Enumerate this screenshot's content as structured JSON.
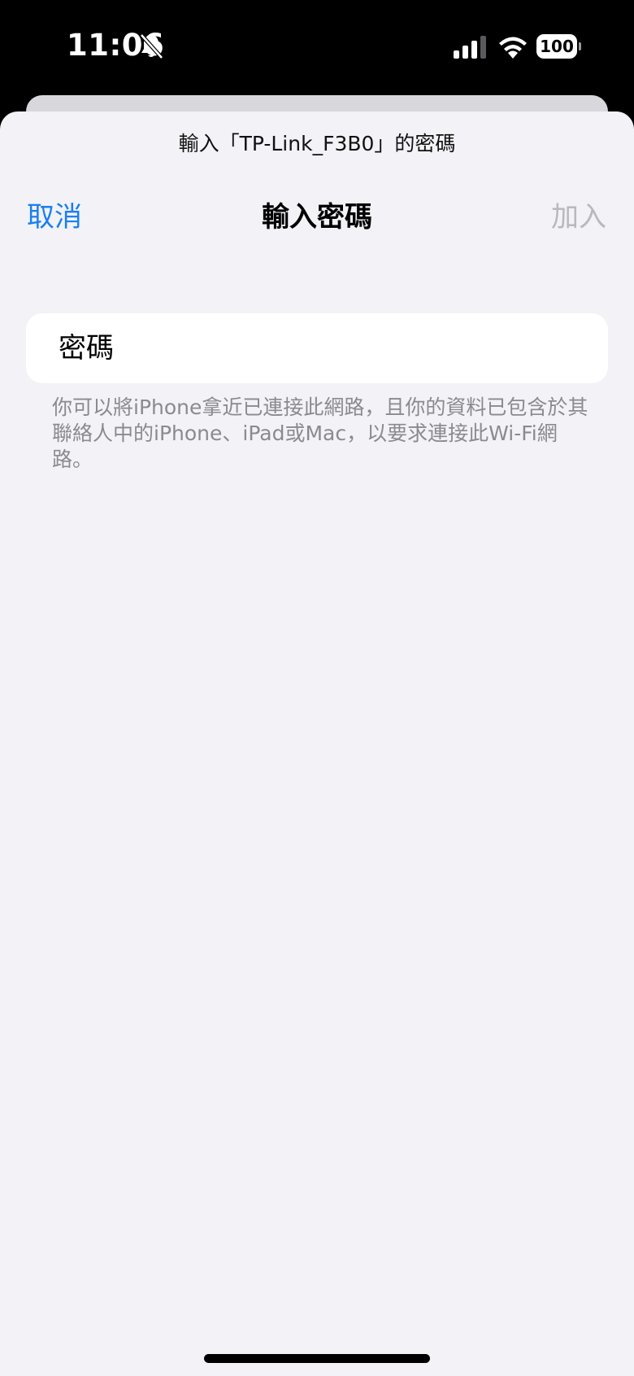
{
  "status_bar": {
    "time": "11:06",
    "battery_level": "100",
    "icons": [
      "bell-slash-icon",
      "cellular-signal-icon",
      "wifi-icon",
      "battery-icon"
    ]
  },
  "sheet": {
    "prompt": "輸入「TP-Link_F3B0」的密碼",
    "nav": {
      "cancel_label": "取消",
      "title": "輸入密碼",
      "join_label": "加入"
    },
    "password_field": {
      "label": "密碼",
      "value": ""
    },
    "footer_note": "你可以將iPhone拿近已連接此網路，且你的資料已包含於其聯絡人中的iPhone、iPad或Mac，以要求連接此Wi-Fi網路。"
  },
  "colors": {
    "accent": "#1a7ff0",
    "disabled": "#b8b8bd",
    "sheet_background": "#f2f2f7",
    "footer_text": "#8a8a8f"
  }
}
